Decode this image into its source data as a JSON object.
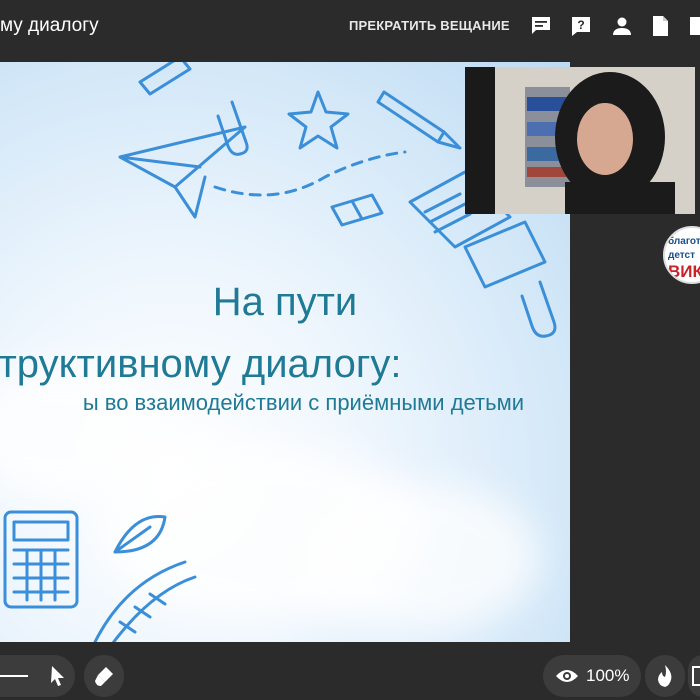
{
  "header": {
    "title": "му диалогу",
    "stop_broadcast_label": "ПРЕКРАТИТЬ ВЕЩАНИЕ",
    "icons": [
      "chat-icon",
      "question-icon",
      "person-icon",
      "document-icon"
    ]
  },
  "slide": {
    "title_line1": "На пути",
    "title_line2": "структивному диалогу:",
    "subtitle": "ы во взаимодействии с приёмными детьми"
  },
  "avatar": {
    "line1": "благот",
    "line2": "детст",
    "line3": "ВИК"
  },
  "toolbar": {
    "zoom": "100%",
    "icons": [
      "pointer-icon",
      "brush-icon",
      "eye-icon",
      "flame-icon"
    ]
  },
  "colors": {
    "background": "#2b2b2b",
    "slide_title": "#1f7a96",
    "doodle": "#3a8fd8"
  }
}
